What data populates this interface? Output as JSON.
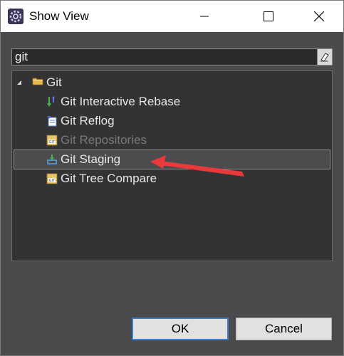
{
  "window": {
    "title": "Show View",
    "icon": "eclipse-gear-icon",
    "controls": [
      "minimize",
      "maximize",
      "close"
    ]
  },
  "search": {
    "value": "git"
  },
  "tree": {
    "items": [
      {
        "label": "Git",
        "icon": "folder-icon",
        "expanded": true,
        "level": 0
      },
      {
        "label": "Git Interactive Rebase",
        "icon": "rebase-icon",
        "level": 1
      },
      {
        "label": "Git Reflog",
        "icon": "reflog-icon",
        "level": 1
      },
      {
        "label": "Git Repositories",
        "icon": "repositories-icon",
        "level": 1,
        "disabled": true
      },
      {
        "label": "Git Staging",
        "icon": "staging-icon",
        "level": 1,
        "selected": true
      },
      {
        "label": "Git Tree Compare",
        "icon": "tree-compare-icon",
        "level": 1
      }
    ]
  },
  "buttons": {
    "ok": "OK",
    "cancel": "Cancel"
  },
  "colors": {
    "annotation_arrow": "#e83a3a",
    "dialog_background": "#4a4a4d",
    "tree_background": "#333336",
    "ok_border": "#3c7fc8"
  }
}
